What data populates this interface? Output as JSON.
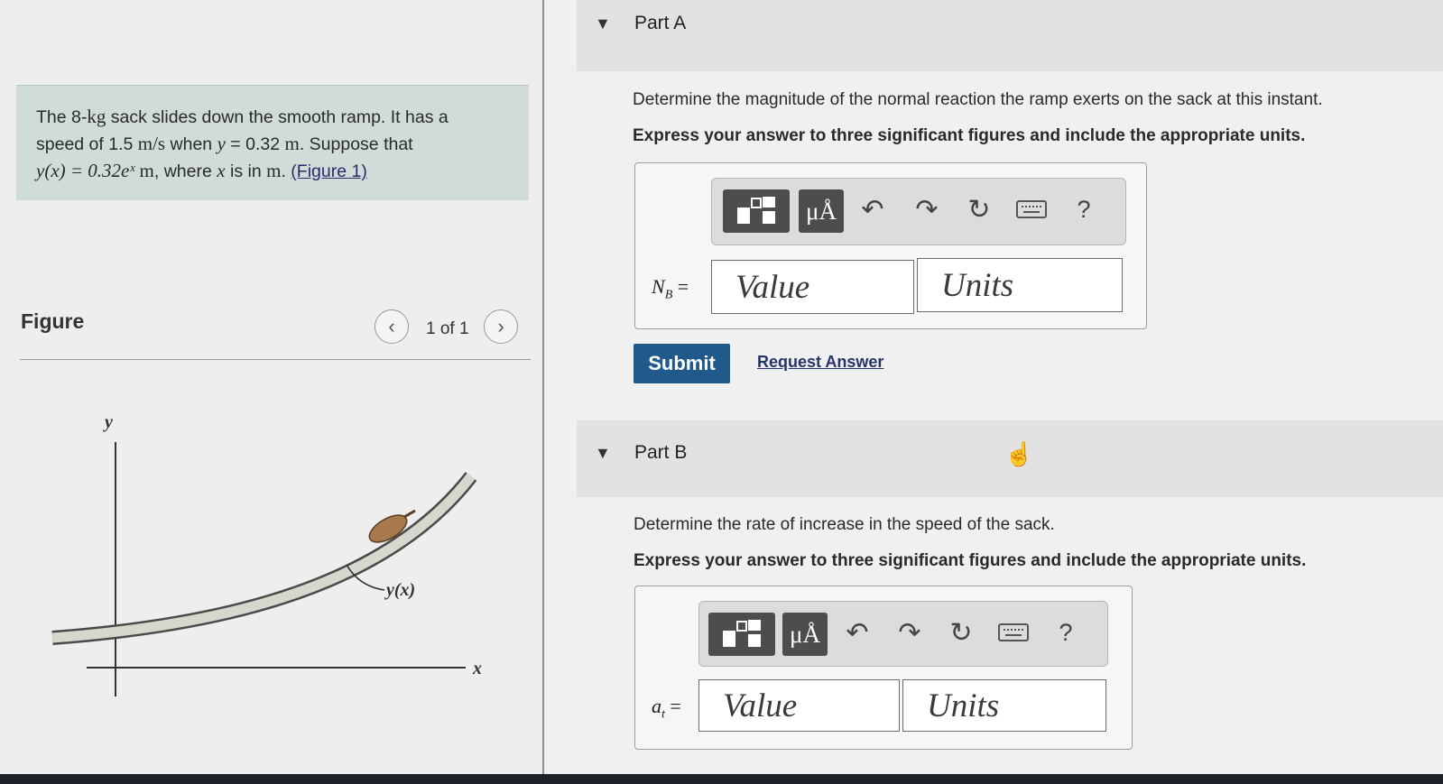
{
  "problem": {
    "text_1": "The 8-",
    "mass_unit": "kg",
    "text_2": " sack slides down the smooth ramp. It has a",
    "text_3": "speed of 1.5 ",
    "speed_unit": "m/s",
    "text_4": " when ",
    "var_y": "y",
    "text_5": " = 0.32 ",
    "len_unit": "m",
    "text_6": ". Suppose that",
    "equation": "y(x) = 0.32eˣ",
    "eq_unit": " m",
    "text_7": ", where ",
    "var_x": "x",
    "text_8": " is in ",
    "len_unit2": "m",
    "text_9": ". ",
    "figure_link": "(Figure 1)"
  },
  "figure": {
    "title": "Figure",
    "prev_icon": "chevron-left-icon",
    "next_icon": "chevron-right-icon",
    "page_indicator": "1 of 1",
    "y_axis_label": "y",
    "x_axis_label": "x",
    "curve_label": "y(x)"
  },
  "part_a": {
    "title": "Part A",
    "question": "Determine the magnitude of the normal reaction the ramp exerts on the sack at this instant.",
    "instruction": "Express your answer to three significant figures and include the appropriate units.",
    "symbol": "N",
    "symbol_sub": "B",
    "equals": " =",
    "value_placeholder": "Value",
    "units_placeholder": "Units",
    "submit_label": "Submit",
    "request_label": "Request Answer"
  },
  "part_b": {
    "title": "Part B",
    "question": "Determine the rate of increase in the speed of the sack.",
    "instruction": "Express your answer to three significant figures and include the appropriate units.",
    "symbol": "a",
    "symbol_sub": "t",
    "equals": " =",
    "value_placeholder": "Value",
    "units_placeholder": "Units"
  },
  "toolbar": {
    "templates_icon": "templates-icon",
    "symbols_label": "μÅ",
    "undo_icon": "undo-icon",
    "redo_icon": "redo-icon",
    "reset_icon": "reset-icon",
    "keyboard_icon": "keyboard-icon",
    "help_label": "?"
  },
  "colors": {
    "problem_bg": "#cfdcd8",
    "submit_bg": "#1f5a8a",
    "link": "#26346a"
  }
}
